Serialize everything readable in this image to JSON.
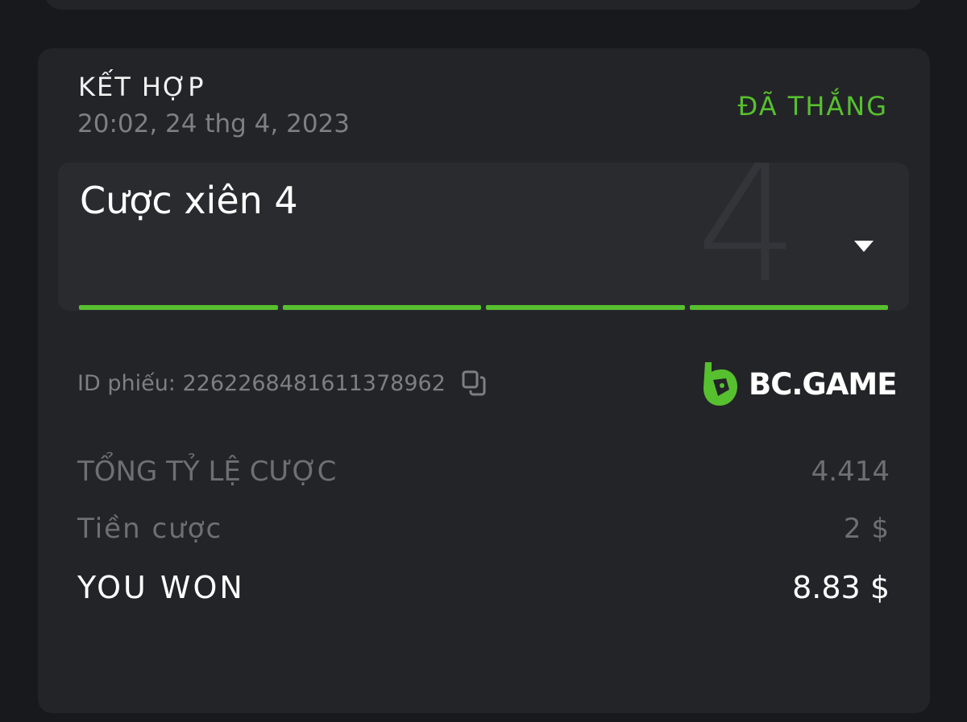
{
  "bet": {
    "type": "KẾT HỢP",
    "datetime": "20:02, 24 thg 4, 2023",
    "status": "ĐÃ THẮNG",
    "title": "Cược xiên 4",
    "leg_count_display": "4",
    "legs": [
      "won",
      "won",
      "won",
      "won"
    ]
  },
  "ticket": {
    "label": "ID phiếu: 2262268481611378962"
  },
  "brand": {
    "name": "BC.GAME"
  },
  "summary": {
    "odds_label": "TỔNG TỶ LỆ CƯỢC",
    "odds_value": "4.414",
    "stake_label": "Tiền cược",
    "stake_value": "2 $",
    "won_label": "YOU WON",
    "won_value": "8.83 $"
  },
  "colors": {
    "background": "#18191c",
    "card": "#232428",
    "inner": "#2a2b2f",
    "accent_green": "#57c02f",
    "muted_text": "#7d7f84"
  },
  "icons": {
    "copy": "copy-icon",
    "dropdown": "chevron-down-icon",
    "logo": "bcgame-logo-icon"
  }
}
